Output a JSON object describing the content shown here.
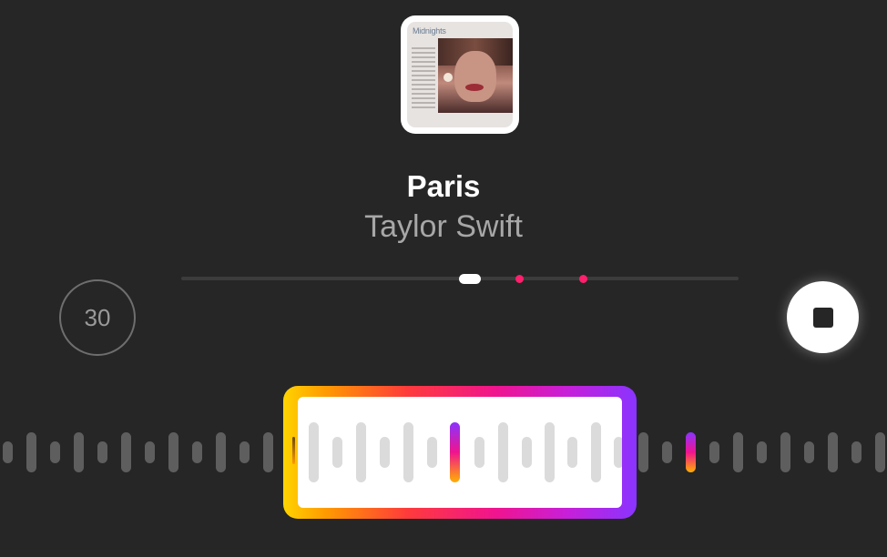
{
  "album": {
    "title": "Midnights"
  },
  "track": {
    "title": "Paris",
    "artist": "Taylor Swift"
  },
  "controls": {
    "skip_label": "30"
  },
  "icons": {
    "skip": "replay-30-icon",
    "stop": "stop-icon"
  },
  "colors": {
    "background": "#262626",
    "marker": "#ff1f6d",
    "frame_gradient": [
      "#ffd400",
      "#ff3b3b",
      "#f0148e",
      "#8a34ff"
    ]
  }
}
